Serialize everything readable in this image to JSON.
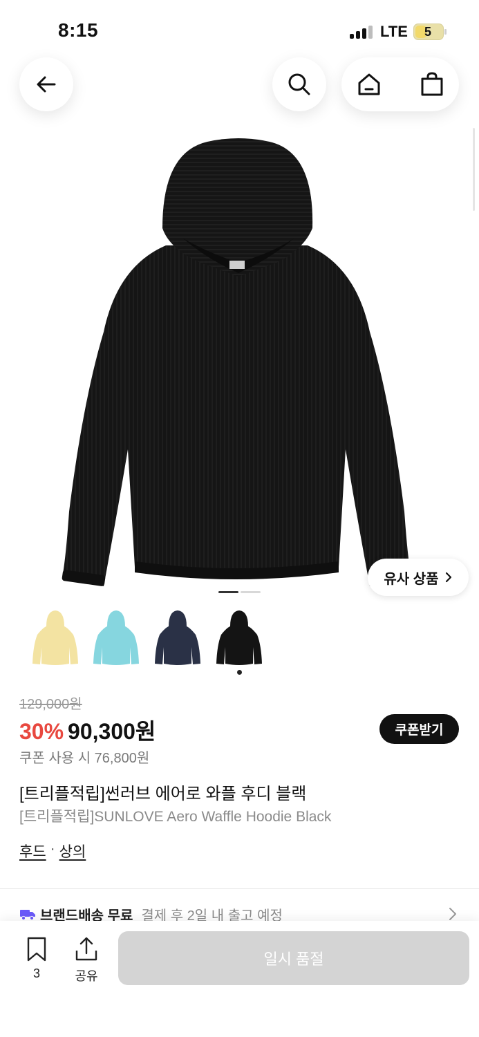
{
  "status_bar": {
    "time": "8:15",
    "network": "LTE",
    "battery": "5"
  },
  "nav": {
    "back_icon": "arrow-left-icon",
    "search_icon": "search-icon",
    "home_icon": "home-icon",
    "bag_icon": "shopping-bag-icon"
  },
  "hero": {
    "similar_label": "유사 상품",
    "image_count": 2,
    "active_image": 0
  },
  "color_options": [
    {
      "name": "yellow",
      "color": "#f3e3a2"
    },
    {
      "name": "sky-blue",
      "color": "#86d6df"
    },
    {
      "name": "navy",
      "color": "#2a3146"
    },
    {
      "name": "black",
      "color": "#141414",
      "selected": true
    }
  ],
  "price": {
    "original": "129,000원",
    "discount": "30%",
    "sale": "90,300원",
    "coupon_button": "쿠폰받기",
    "coupon_note": "쿠폰 사용 시 76,800원",
    "discount_color": "#e8483f"
  },
  "product": {
    "title_ko": "[트리플적립]썬러브 에어로 와플 후디 블랙",
    "title_en": "[트리플적립]SUNLOVE Aero Waffle Hoodie Black",
    "categories": [
      "후드",
      "상의"
    ],
    "category_separator": "·"
  },
  "delivery": {
    "icon": "truck-icon",
    "label": "브랜드배송 무료",
    "note": "결제 후 2일 내 출고 예정",
    "icon_color": "#6a5af9"
  },
  "bottom_bar": {
    "bookmark_count": "3",
    "share_label": "공유",
    "soldout_label": "일시 품절"
  }
}
